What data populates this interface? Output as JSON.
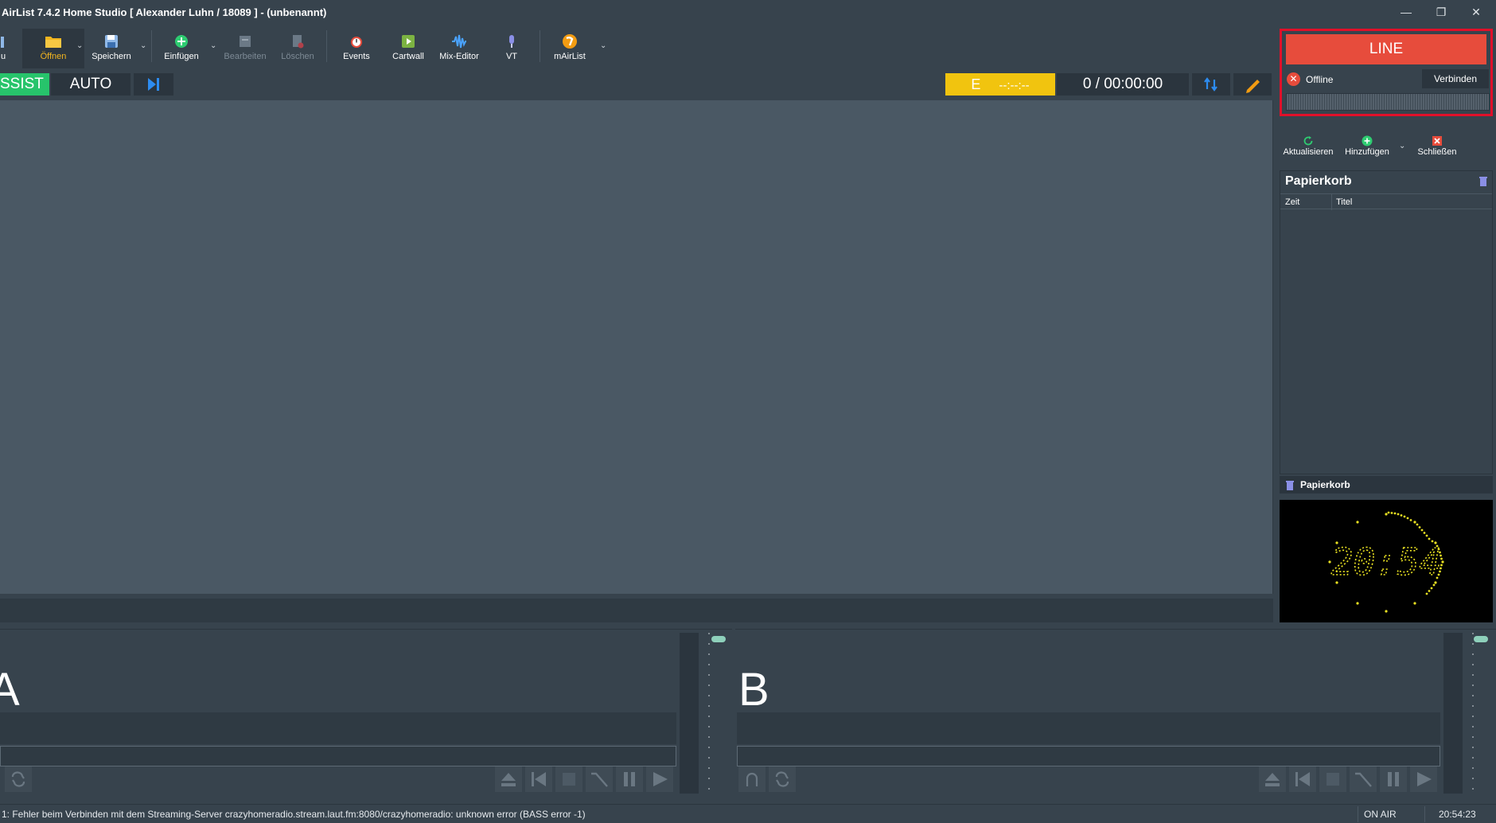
{
  "window": {
    "title": "AirList 7.4.2 Home Studio [ Alexander Luhn / 18089 ] - (unbenannt)",
    "minimize": "—",
    "restore": "❐",
    "close": "✕"
  },
  "toolbar": {
    "partial_label": "u",
    "open_label": "Öffnen",
    "save_label": "Speichern",
    "insert_label": "Einfügen",
    "edit_label": "Bearbeiten",
    "delete_label": "Löschen",
    "events_label": "Events",
    "cartwall_label": "Cartwall",
    "mix_editor_label": "Mix-Editor",
    "vt_label": "VT",
    "mairlist_label": "mAirList"
  },
  "modebar": {
    "assist_label": "SSIST",
    "auto_label": "AUTO",
    "event_label": "E",
    "event_time": "--:--:--",
    "counter": "0 / 00:00:00"
  },
  "line_panel": {
    "line_label": "LINE",
    "status": "Offline",
    "connect_label": "Verbinden"
  },
  "side_toolbar": {
    "refresh_label": "Aktualisieren",
    "add_label": "Hinzufügen",
    "close_label": "Schließen"
  },
  "trash": {
    "title": "Papierkorb",
    "col_time": "Zeit",
    "col_title": "Titel",
    "tab_label": "Papierkorb"
  },
  "clock": {
    "time": "20:54"
  },
  "players": {
    "a_label": "A",
    "b_label": "B"
  },
  "statusbar": {
    "message": "1: Fehler beim Verbinden mit dem Streaming-Server crazyhomeradio.stream.laut.fm:8080/crazyhomeradio: unknown error (BASS error -1)",
    "onair": "ON AIR",
    "time": "20:54:23"
  },
  "colors": {
    "background": "#37434d",
    "playlist": "#4a5864",
    "assist_green": "#27c46b",
    "event_yellow": "#f1c40f",
    "line_red": "#e74c3c",
    "highlight_border": "#e0102a",
    "clock_led": "#e8e022"
  }
}
